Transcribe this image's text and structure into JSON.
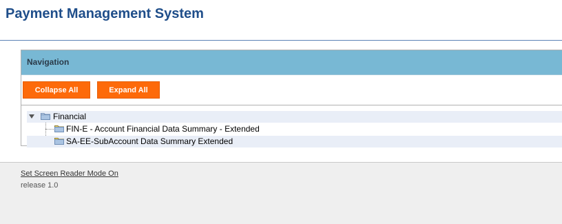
{
  "header": {
    "title": "Payment Management System"
  },
  "navigation": {
    "title": "Navigation",
    "collapse_label": "Collapse All",
    "expand_label": "Expand All",
    "tree": {
      "root": {
        "label": "Financial",
        "expanded": true,
        "icon": "folder-icon",
        "children": [
          {
            "label": "FIN-E - Account Financial Data Summary - Extended",
            "icon": "folder-icon"
          },
          {
            "label": "SA-EE-SubAccount Data Summary Extended",
            "icon": "folder-icon"
          }
        ]
      }
    }
  },
  "footer": {
    "screen_reader_link": "Set Screen Reader Mode On",
    "release": "release 1.0"
  },
  "colors": {
    "title": "#1f4e8a",
    "nav_header_bg": "#78b8d4",
    "button_bg": "#fd6a0a",
    "row_highlight": "#e9eef7",
    "footer_bg": "#efefef"
  }
}
